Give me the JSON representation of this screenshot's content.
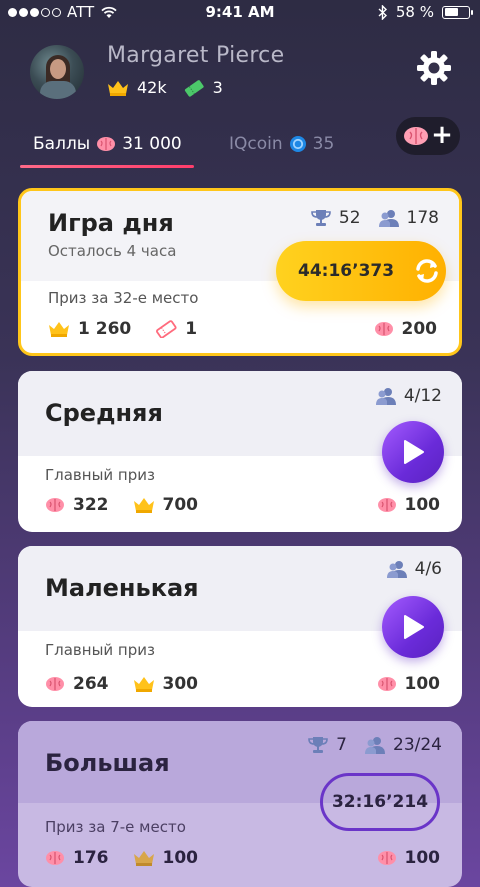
{
  "status_bar": {
    "carrier": "ATT",
    "time": "9:41 AM",
    "battery_text": "58 %",
    "battery_level": 0.58,
    "signal_bars_filled": 3,
    "signal_bars_total": 5
  },
  "profile": {
    "name": "Margaret Pierce",
    "crowns": "42k",
    "tickets": "3"
  },
  "tabs": {
    "balls": {
      "label": "Баллы",
      "value": "31 000"
    },
    "iqcoin": {
      "label": "IQcoin",
      "value": "35"
    }
  },
  "colors": {
    "accent_yellow": "#ffc61a",
    "accent_purple": "#6a2bd9",
    "tab_underline": "#ff3d6b"
  },
  "games": [
    {
      "title": "Игра дня",
      "subtitle": "Осталось 4 часа",
      "trophies": "52",
      "players": "178",
      "timer": "44:16’373",
      "prize_label": "Приз за 32-е место",
      "prize_crowns": "1 260",
      "prize_tickets": "1",
      "entry_cost": "200"
    },
    {
      "title": "Средняя",
      "players": "4/12",
      "prize_label": "Главный приз",
      "prize_brains": "322",
      "prize_crowns": "700",
      "entry_cost": "100"
    },
    {
      "title": "Маленькая",
      "players": "4/6",
      "prize_label": "Главный приз",
      "prize_brains": "264",
      "prize_crowns": "300",
      "entry_cost": "100"
    },
    {
      "title": "Большая",
      "trophies": "7",
      "players": "23/24",
      "timer": "32:16’214",
      "prize_label": "Приз за 7-е место",
      "prize_brains": "176",
      "prize_crowns": "100",
      "entry_cost": "100"
    }
  ]
}
